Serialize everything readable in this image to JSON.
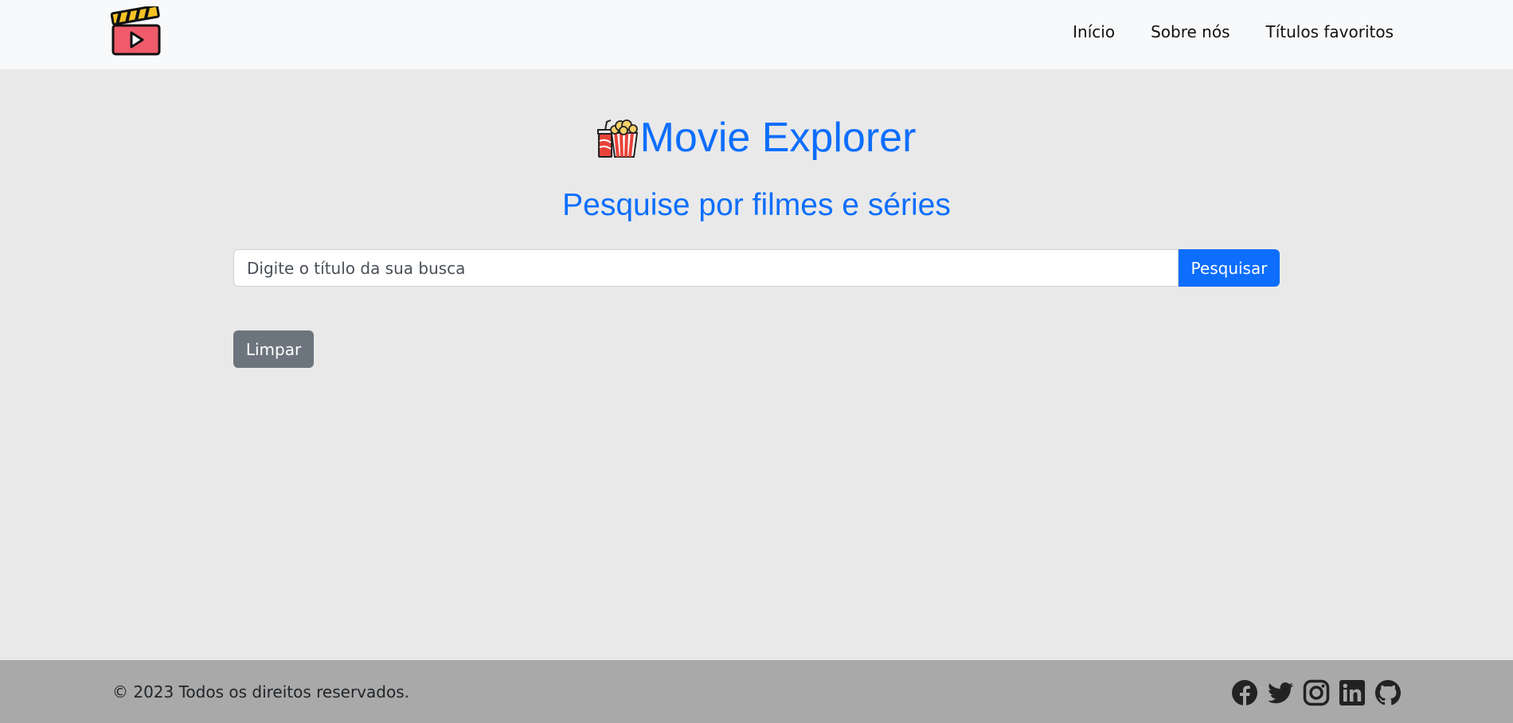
{
  "header": {
    "logo_icon": "clapperboard-play-icon",
    "nav": [
      {
        "label": "Início"
      },
      {
        "label": "Sobre nós"
      },
      {
        "label": "Títulos favoritos"
      }
    ]
  },
  "main": {
    "title_icon": "popcorn-icon",
    "title": "Movie Explorer",
    "subtitle": "Pesquise por filmes e séries",
    "search": {
      "placeholder": "Digite o título da sua busca",
      "value": "",
      "button_label": "Pesquisar"
    },
    "clear_label": "Limpar"
  },
  "footer": {
    "copyright": "© 2023 Todos os direitos reservados.",
    "social_icons": [
      "facebook-icon",
      "twitter-icon",
      "instagram-icon",
      "linkedin-icon",
      "github-icon"
    ]
  },
  "colors": {
    "primary": "#0d6efd",
    "secondary": "#6c757d",
    "navbar_bg": "#f8f9fa",
    "page_bg": "#e9e9e9",
    "footer_bg": "#a9a9a9"
  }
}
